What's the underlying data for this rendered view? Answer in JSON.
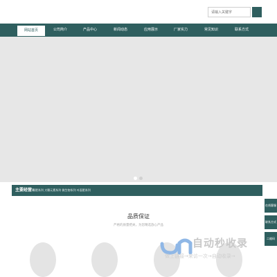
{
  "search": {
    "placeholder": "请输入关键字"
  },
  "nav": {
    "items": [
      {
        "label": "网站首页"
      },
      {
        "label": "公司简介"
      },
      {
        "label": "产品中心"
      },
      {
        "label": "新闻动态"
      },
      {
        "label": "应用展示"
      },
      {
        "label": "厂家实力"
      },
      {
        "label": "常见知识"
      },
      {
        "label": "联系方式"
      }
    ],
    "active_index": 0
  },
  "main_products": {
    "label": "主要经营:",
    "items": "颗肥系列 大颗元素系列 微生物系列 叶面肥系列"
  },
  "quality": {
    "title": "品质保证",
    "subtitle": "严格的质量把关，为您精选放心产品"
  },
  "side_buttons": [
    {
      "label": "在线客服"
    },
    {
      "label": "联系方式"
    },
    {
      "label": "二维码"
    }
  ],
  "watermark": {
    "title": "自动秒收录",
    "subtitle": "做上链接→来访一次→自动收录→"
  },
  "colors": {
    "primary": "#2f5f5f",
    "banner": "#e7e7e7"
  }
}
